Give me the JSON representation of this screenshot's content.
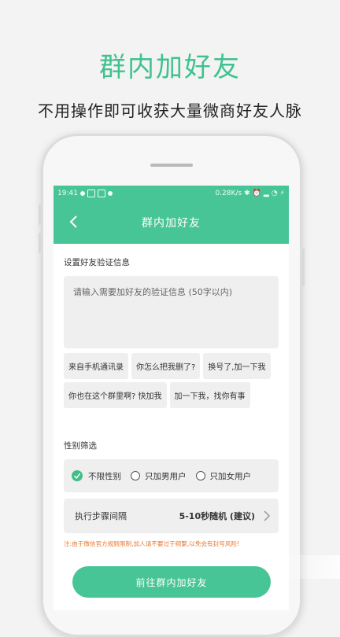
{
  "headline": "群内加好友",
  "subline": "不用操作即可收获大量微商好友人脉",
  "status_bar": {
    "time": "19:41",
    "speed": "0.28K/s"
  },
  "nav": {
    "title": "群内加好友"
  },
  "verify": {
    "section_title": "设置好友验证信息",
    "placeholder": "请输入需要加好友的验证信息 (50字以内)",
    "chips": [
      "来自手机通讯录",
      "你怎么把我删了?",
      "换号了,加一下我",
      "你也在这个群里啊? 快加我",
      "加一下我，找你有事"
    ]
  },
  "gender": {
    "section_title": "性别筛选",
    "options": [
      "不限性别",
      "只加男用户",
      "只加女用户"
    ],
    "selected": "不限性别"
  },
  "step": {
    "label": "执行步骤间隔",
    "value": "5-10秒随机 (建议)"
  },
  "notice": "注:由于微信官方规则限制,加人请不要过于频繁,以免会有封号风险!",
  "primary_button": "前往群内加好友",
  "colors": {
    "accent": "#48c596",
    "warning": "#e8762c"
  }
}
